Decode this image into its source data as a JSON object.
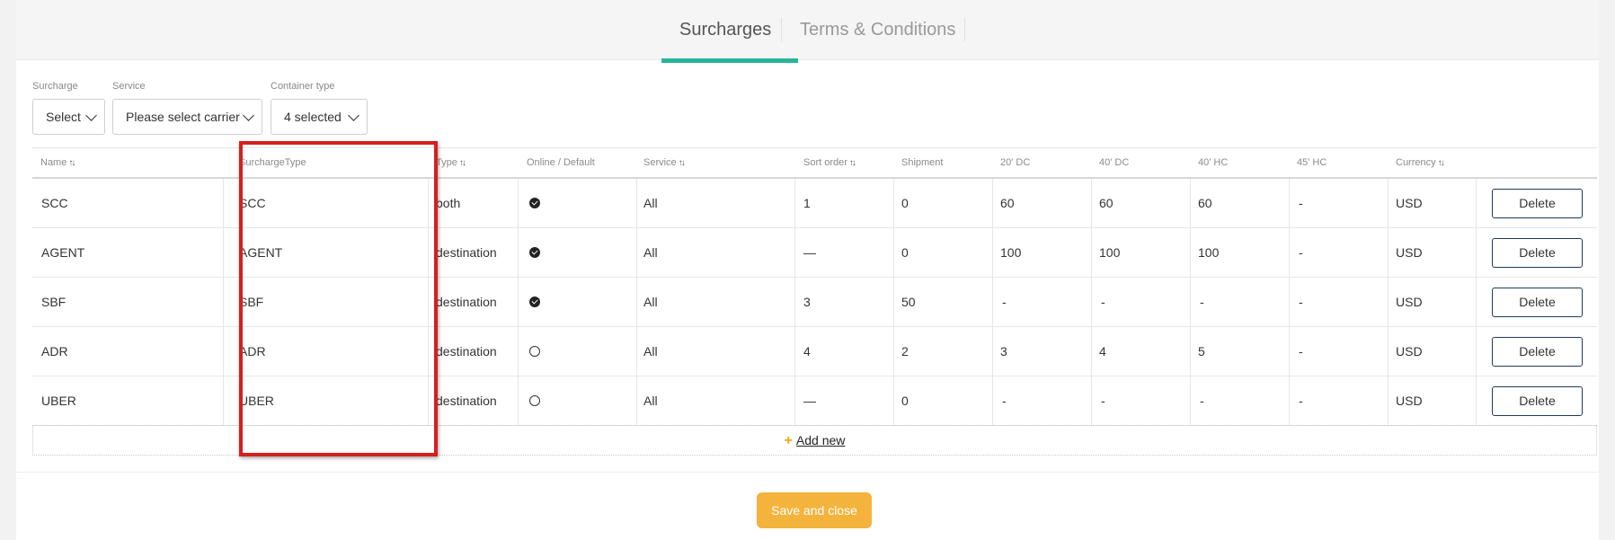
{
  "tabs": {
    "surcharges": "Surcharges",
    "terms": "Terms & Conditions"
  },
  "filters": {
    "surcharge": {
      "label": "Surcharge",
      "value": "Select"
    },
    "service": {
      "label": "Service",
      "value": "Please select carrier"
    },
    "container_type": {
      "label": "Container type",
      "value": "4 selected"
    }
  },
  "table": {
    "headers": {
      "name": "Name",
      "surcharge_type": "SurchargeType",
      "type": "Type",
      "online_default": "Online / Default",
      "service": "Service",
      "sort_order": "Sort order",
      "shipment": "Shipment",
      "dc20": "20' DC",
      "dc40": "40' DC",
      "hc40": "40' HC",
      "hc45": "45' HC",
      "currency": "Currency",
      "sort_icon": "↑↓"
    },
    "rows": [
      {
        "name": "SCC",
        "surcharge_type": "SCC",
        "type": "both",
        "online": "checked",
        "service": "All",
        "sort_order": "1",
        "shipment": "0",
        "dc20": "60",
        "dc40": "60",
        "hc40": "60",
        "hc45": "-",
        "currency": "USD",
        "delete": "Delete"
      },
      {
        "name": "AGENT",
        "surcharge_type": "AGENT",
        "type": "destination",
        "online": "checked",
        "service": "All",
        "sort_order": "—",
        "shipment": "0",
        "dc20": "100",
        "dc40": "100",
        "hc40": "100",
        "hc45": "-",
        "currency": "USD",
        "delete": "Delete"
      },
      {
        "name": "SBF",
        "surcharge_type": "SBF",
        "type": "destination",
        "online": "checked",
        "service": "All",
        "sort_order": "3",
        "shipment": "50",
        "dc20": "-",
        "dc40": "-",
        "hc40": "-",
        "hc45": "-",
        "currency": "USD",
        "delete": "Delete"
      },
      {
        "name": "ADR",
        "surcharge_type": "ADR",
        "type": "destination",
        "online": "unchecked",
        "service": "All",
        "sort_order": "4",
        "shipment": "2",
        "dc20": "3",
        "dc40": "4",
        "hc40": "5",
        "hc45": "-",
        "currency": "USD",
        "delete": "Delete"
      },
      {
        "name": "UBER",
        "surcharge_type": "UBER",
        "type": "destination",
        "online": "unchecked",
        "service": "All",
        "sort_order": "—",
        "shipment": "0",
        "dc20": "-",
        "dc40": "-",
        "hc40": "-",
        "hc45": "-",
        "currency": "USD",
        "delete": "Delete"
      }
    ],
    "add_new": "Add new",
    "add_icon": "+"
  },
  "footer": {
    "save_and_close": "Save and close"
  },
  "colors": {
    "accent_tab": "#26b59a",
    "save_button": "#f3b33d",
    "highlight_box": "#d61f1f"
  }
}
